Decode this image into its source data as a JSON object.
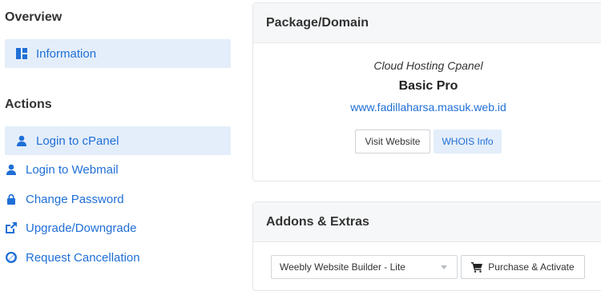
{
  "sidebar": {
    "overview_title": "Overview",
    "overview_items": [
      {
        "label": "Information",
        "icon": "dashboard-icon"
      }
    ],
    "actions_title": "Actions",
    "actions_items": [
      {
        "label": "Login to cPanel",
        "icon": "user-icon"
      },
      {
        "label": "Login to Webmail",
        "icon": "user-icon"
      },
      {
        "label": "Change Password",
        "icon": "lock-icon"
      },
      {
        "label": "Upgrade/Downgrade",
        "icon": "external-link-icon"
      },
      {
        "label": "Request Cancellation",
        "icon": "ban-icon"
      }
    ]
  },
  "package_panel": {
    "title": "Package/Domain",
    "product_type": "Cloud Hosting Cpanel",
    "product_name": "Basic Pro",
    "domain": "www.fadillaharsa.masuk.web.id",
    "visit_label": "Visit Website",
    "whois_label": "WHOIS Info"
  },
  "addons_panel": {
    "title": "Addons & Extras",
    "selected_addon": "Weebly Website Builder - Lite",
    "purchase_label": "Purchase & Activate",
    "purchase_icon": "cart-icon"
  },
  "colors": {
    "accent": "#1f6fd6",
    "active_bg": "#e4eefa",
    "panel_header_bg": "#f6f7f8"
  }
}
